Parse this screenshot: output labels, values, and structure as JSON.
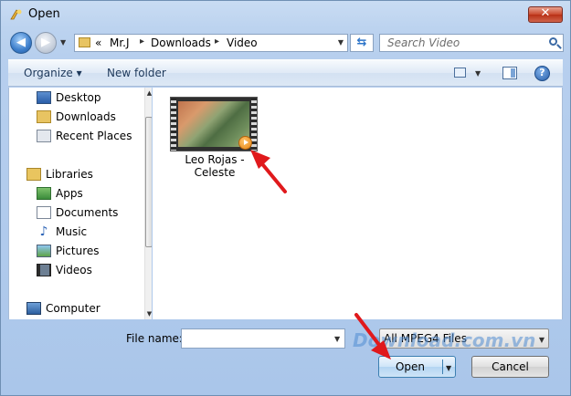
{
  "window": {
    "title": "Open",
    "close_glyph": "✕"
  },
  "address": {
    "overflow": "«",
    "crumbs": [
      "Mr.J",
      "Downloads",
      "Video"
    ],
    "sep": "▸"
  },
  "search": {
    "placeholder": "Search Video"
  },
  "toolbar": {
    "organize": "Organize ▾",
    "new_folder": "New folder",
    "help": "?"
  },
  "nav": {
    "items": [
      {
        "label": "Desktop",
        "icon": "desktop-icon"
      },
      {
        "label": "Downloads",
        "icon": "downloads-folder-icon"
      },
      {
        "label": "Recent Places",
        "icon": "recent-places-icon"
      },
      {
        "label": "Libraries",
        "icon": "libraries-icon"
      },
      {
        "label": "Apps",
        "icon": "apps-icon"
      },
      {
        "label": "Documents",
        "icon": "documents-icon"
      },
      {
        "label": "Music",
        "icon": "music-icon"
      },
      {
        "label": "Pictures",
        "icon": "pictures-icon"
      },
      {
        "label": "Videos",
        "icon": "videos-icon"
      },
      {
        "label": "Computer",
        "icon": "computer-icon"
      }
    ]
  },
  "files": [
    {
      "name": "Leo Rojas - Celeste",
      "icon": "video-file-icon"
    }
  ],
  "bottom": {
    "filename_label": "File name:",
    "filename_value": "",
    "filetype": "All MPEG4 Files",
    "open": "Open",
    "cancel": "Cancel"
  },
  "watermark": {
    "text": "Download.com.vn"
  },
  "colors": {
    "annotation_arrow": "#e0191c",
    "accent": "#3c7fb1"
  }
}
